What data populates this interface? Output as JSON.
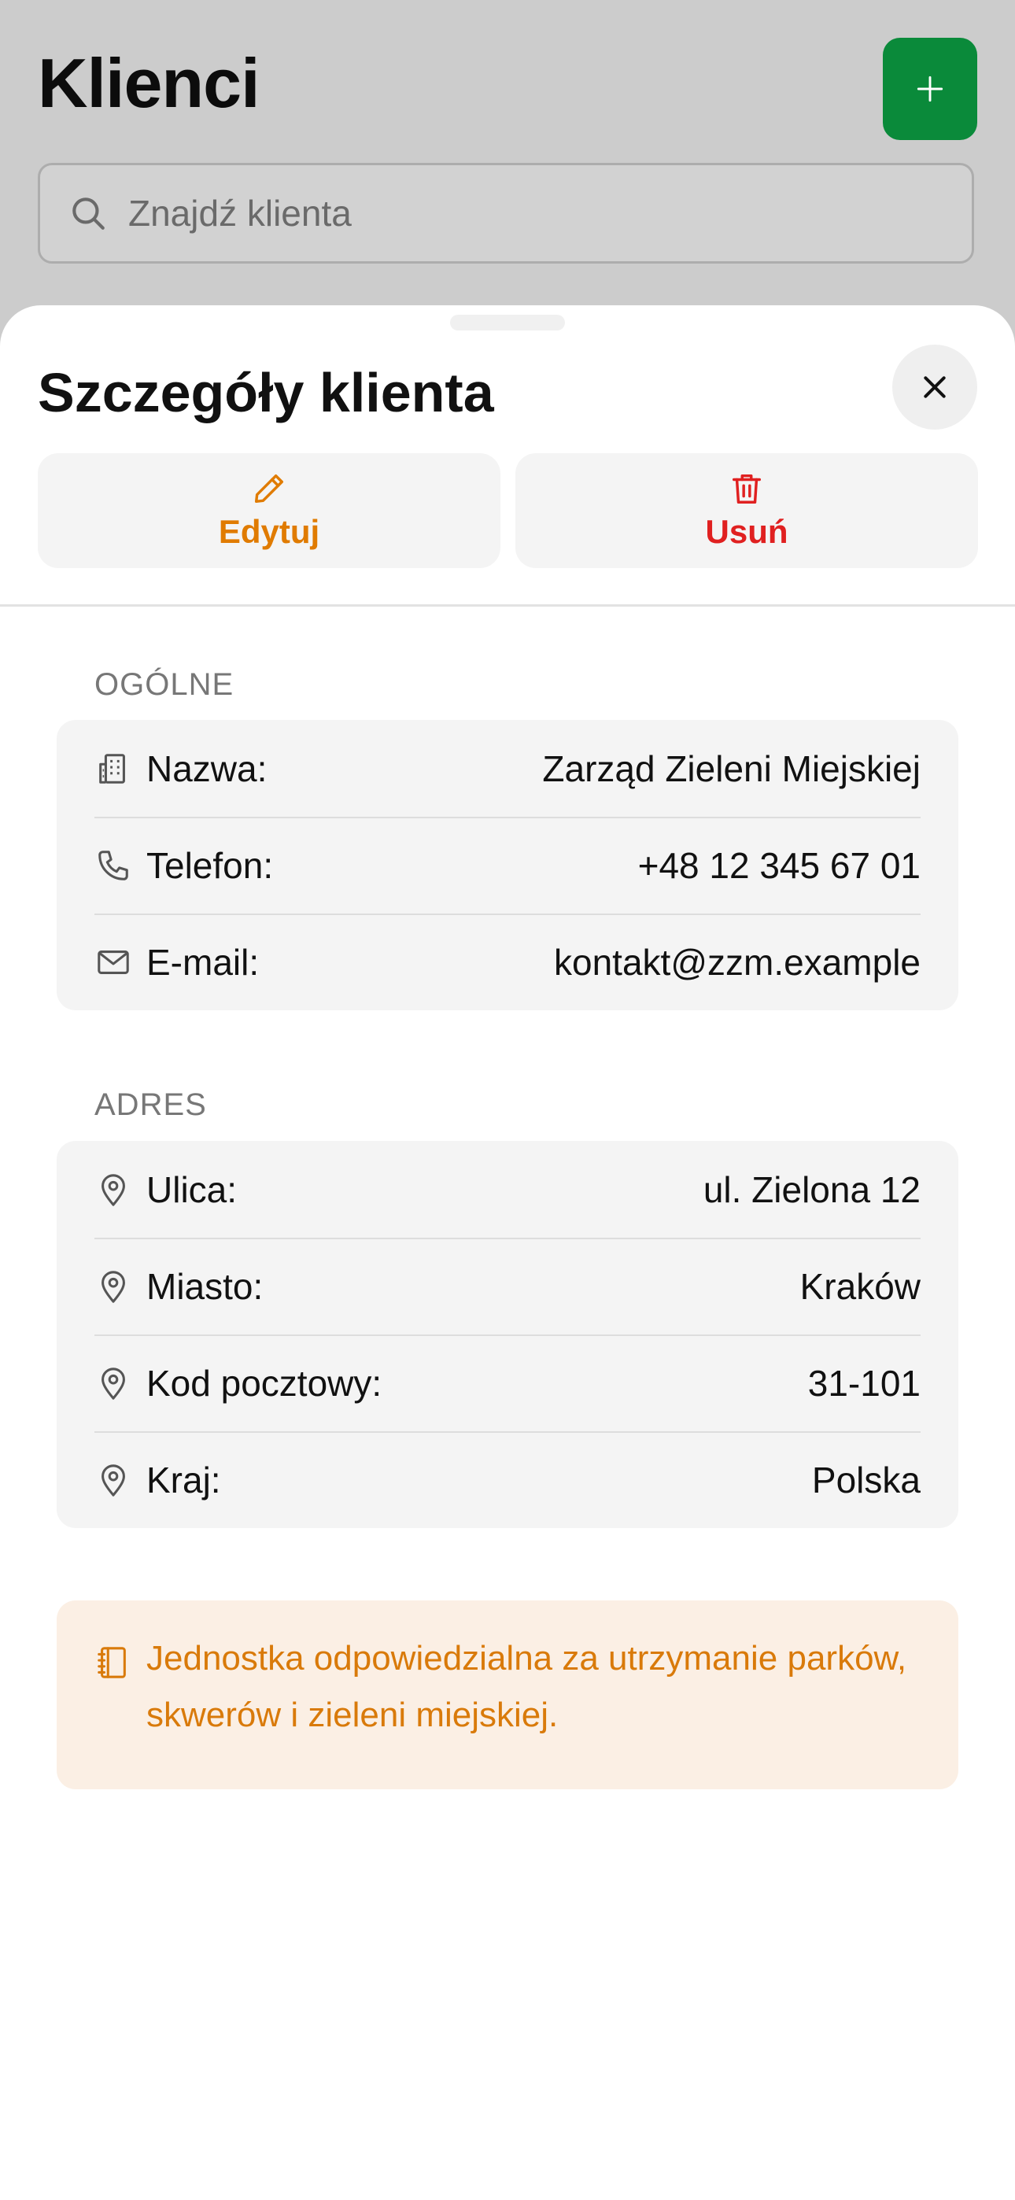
{
  "header": {
    "title": "Klienci",
    "add_icon": "plus-icon"
  },
  "search": {
    "placeholder": "Znajdź klienta",
    "value": ""
  },
  "sheet": {
    "title": "Szczegóły klienta",
    "actions": {
      "edit_label": "Edytuj",
      "delete_label": "Usuń"
    },
    "general": {
      "section_label": "OGÓLNE",
      "rows": [
        {
          "icon": "building-icon",
          "label": "Nazwa:",
          "value": "Zarząd Zieleni Miejskiej"
        },
        {
          "icon": "phone-icon",
          "label": "Telefon:",
          "value": "+48 12 345 67 01"
        },
        {
          "icon": "mail-icon",
          "label": "E-mail:",
          "value": "kontakt@zzm.example"
        }
      ]
    },
    "address": {
      "section_label": "ADRES",
      "rows": [
        {
          "icon": "map-pin-icon",
          "label": "Ulica:",
          "value": "ul. Zielona 12"
        },
        {
          "icon": "map-pin-icon",
          "label": "Miasto:",
          "value": "Kraków"
        },
        {
          "icon": "map-pin-icon",
          "label": "Kod pocztowy:",
          "value": "31-101"
        },
        {
          "icon": "map-pin-icon",
          "label": "Kraj:",
          "value": "Polska"
        }
      ]
    },
    "note": {
      "icon": "notebook-icon",
      "text": "Jednostka odpowiedzialna za utrzymanie parków, skwerów i zieleni miejskiej."
    }
  },
  "colors": {
    "accent_green": "#0a8a3a",
    "edit_orange": "#e07b00",
    "delete_red": "#e02020",
    "note_text": "#d97a0a",
    "note_bg": "#fbefe4"
  }
}
